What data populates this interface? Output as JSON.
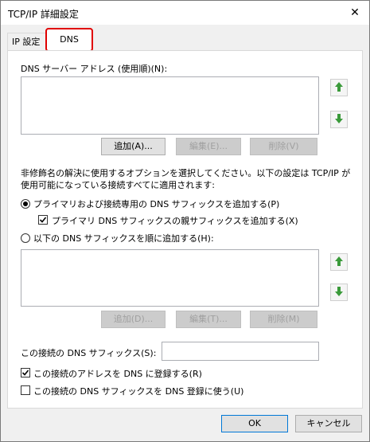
{
  "window": {
    "title": "TCP/IP 詳細設定"
  },
  "tabs": [
    {
      "label": "IP 設定"
    },
    {
      "label": "DNS"
    }
  ],
  "dns_servers": {
    "label": "DNS サーバー アドレス (使用順)(N):",
    "items": [],
    "add_label": "追加(A)...",
    "edit_label": "編集(E)...",
    "remove_label": "削除(V)"
  },
  "description": {
    "line1": "非修飾名の解決に使用するオプションを選択してください。以下の設定は TCP/IP が",
    "line2": "使用可能になっている接続すべてに適用されます:"
  },
  "options": {
    "primary_radio_label": "プライマリおよび接続専用の DNS サフィックスを追加する(P)",
    "parent_suffix_label": "プライマリ DNS サフィックスの親サフィックスを追加する(X)",
    "order_radio_label": "以下の DNS サフィックスを順に追加する(H):"
  },
  "suffix_list": {
    "items": [],
    "add_label": "追加(D)...",
    "edit_label": "編集(T)...",
    "remove_label": "削除(M)"
  },
  "connection": {
    "suffix_label": "この接続の DNS サフィックス(S):",
    "suffix_value": "",
    "register_label": "この接続のアドレスを DNS に登録する(R)",
    "use_suffix_label": "この接続の DNS サフィックスを DNS 登録に使う(U)"
  },
  "footer": {
    "ok_label": "OK",
    "cancel_label": "キャンセル"
  },
  "state": {
    "primary_radio_checked": true,
    "parent_suffix_checked": true,
    "order_radio_checked": false,
    "register_checked": true,
    "use_suffix_checked": false
  },
  "colors": {
    "arrow_green": "#3a9a3a",
    "highlight_red": "#e00000"
  },
  "icons": {
    "up": "arrow-up-icon",
    "down": "arrow-down-icon",
    "close": "close-icon"
  }
}
